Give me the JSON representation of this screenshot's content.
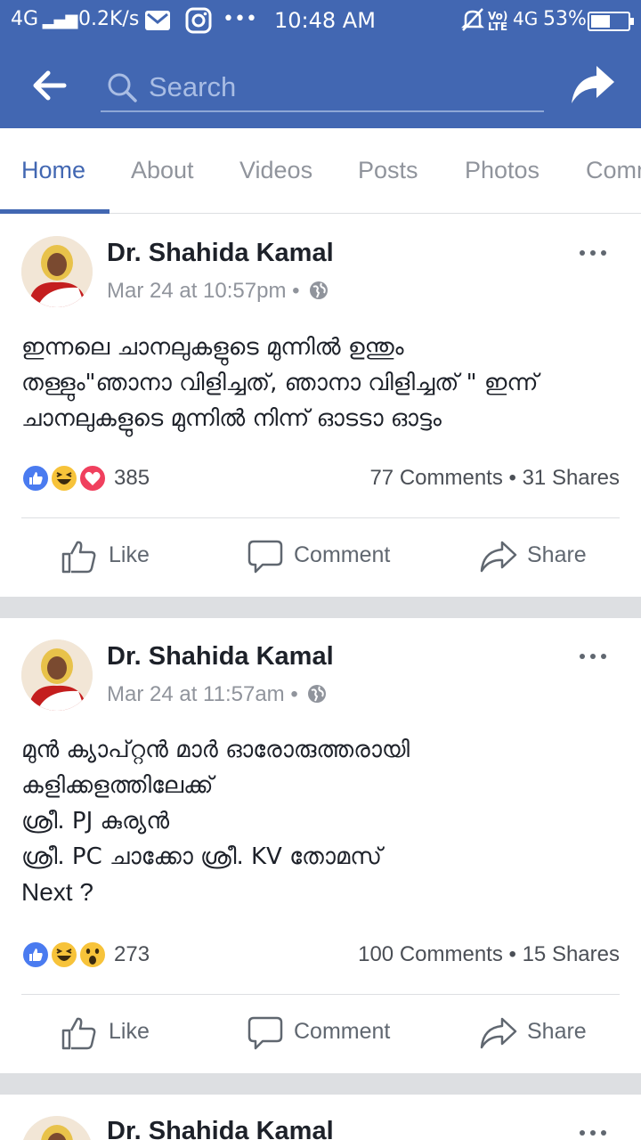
{
  "status_bar": {
    "network": "4G",
    "speed": "0.2K/s",
    "time": "10:48 AM",
    "volte": "VoLTE",
    "network2": "4G",
    "battery": "53%",
    "battery_level": 0.53,
    "icons": [
      "signal-icon",
      "mail-icon",
      "instagram-icon",
      "more-dots-icon",
      "mute-icon",
      "battery-icon"
    ]
  },
  "header": {
    "search_placeholder": "Search",
    "back_icon": "arrow-left-icon",
    "share_icon": "share-arrow-icon",
    "color": "#4267b2"
  },
  "tabs": [
    {
      "label": "Home",
      "active": true
    },
    {
      "label": "About"
    },
    {
      "label": "Videos"
    },
    {
      "label": "Posts"
    },
    {
      "label": "Photos"
    },
    {
      "label": "Comm"
    }
  ],
  "posts": [
    {
      "author": "Dr. Shahida Kamal",
      "timestamp": "Mar 24 at 10:57pm",
      "lines": [
        "ഇന്നലെ ചാനലുകളുടെ മുന്നിൽ ഉന്തും",
        "തള്ളും\"ഞാനാ വിളിച്ചത്, ഞാനാ വിളിച്ചത് \" ഇന്ന്",
        "ചാനലുകളുടെ മുന്നിൽ നിന്ന് ഓടടാ ഓട്ടം"
      ],
      "reactions": [
        "like",
        "haha",
        "love"
      ],
      "reaction_count": "385",
      "comments_shares": "77 Comments • 31 Shares",
      "actions": {
        "like": "Like",
        "comment": "Comment",
        "share": "Share"
      }
    },
    {
      "author": "Dr. Shahida Kamal",
      "timestamp": "Mar 24 at 11:57am",
      "lines": [
        "മുൻ ക്യാപ്റ്റൻ മാർ ഓരോരുത്തരായി",
        "കളിക്കളത്തിലേക്ക്",
        "ശ്രീ. PJ കുര്യൻ",
        "ശ്രീ. PC ചാക്കോ ശ്രീ. KV തോമസ്",
        "Next ?"
      ],
      "reactions": [
        "like",
        "haha",
        "wow"
      ],
      "reaction_count": "273",
      "comments_shares": "100 Comments • 15 Shares",
      "actions": {
        "like": "Like",
        "comment": "Comment",
        "share": "Share"
      }
    },
    {
      "author": "Dr. Shahida Kamal"
    }
  ]
}
